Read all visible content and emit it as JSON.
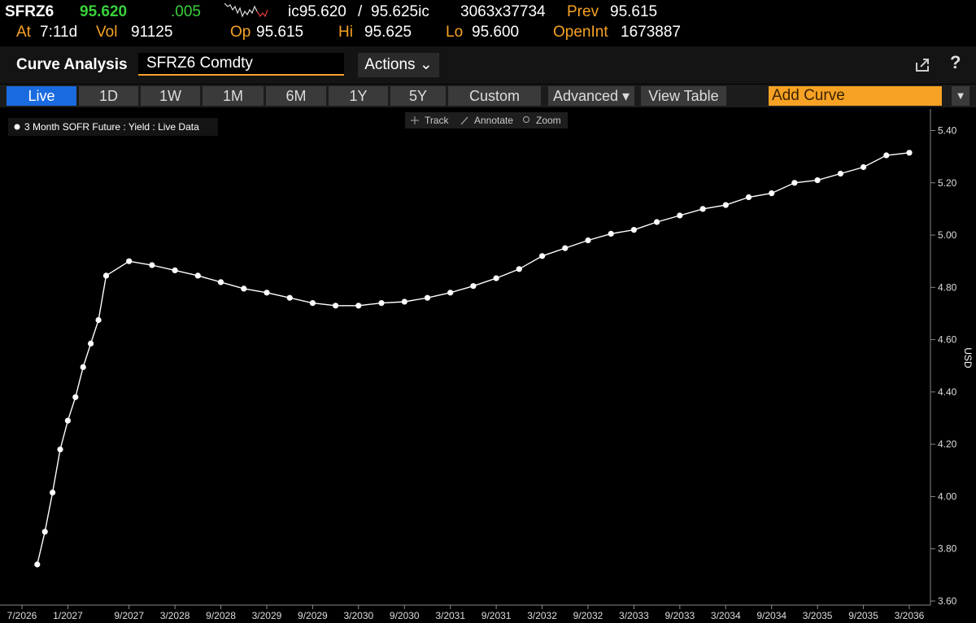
{
  "ticker": {
    "symbol": "SFRZ6",
    "last": "95.620",
    "change": ".005",
    "bid_ask_left": "ic95.620",
    "bid_ask_sep": "/",
    "bid_ask_right": "95.625ic",
    "size": "3063x37734",
    "prev_label": "Prev",
    "prev_value": "95.615",
    "at_label": "At",
    "at_time": "7:11d",
    "vol_label": "Vol",
    "vol_value": "91125",
    "op_label": "Op",
    "op_value": "95.615",
    "hi_label": "Hi",
    "hi_value": "95.625",
    "lo_label": "Lo",
    "lo_value": "95.600",
    "openint_label": "OpenInt",
    "openint_value": "1673887"
  },
  "header": {
    "title": "Curve Analysis",
    "security": "SFRZ6 Comdty",
    "actions_label": "Actions ⌄",
    "help": "?"
  },
  "toolbar": {
    "live": "Live",
    "d1": "1D",
    "w1": "1W",
    "m1": "1M",
    "m6": "6M",
    "y1": "1Y",
    "y5": "5Y",
    "custom": "Custom",
    "advanced": "Advanced ▾",
    "view_table": "View Table",
    "add_curve": "Add Curve",
    "dropdown": "▼"
  },
  "chart_tools": {
    "track": "Track",
    "annotate": "Annotate",
    "zoom": "Zoom"
  },
  "colors": {
    "background": "#000000",
    "line": "#ffffff",
    "accent": "#f7a224",
    "positive": "#3ad13a",
    "active_tab": "#1a6be0"
  },
  "chart_data": {
    "type": "line",
    "legend": "3 Month SOFR Future : Yield : Live Data",
    "ylabel": "USD",
    "ylim": [
      3.6,
      5.44
    ],
    "yticks": [
      "3.60",
      "3.80",
      "4.00",
      "4.20",
      "4.40",
      "4.60",
      "4.80",
      "5.00",
      "5.20",
      "5.40"
    ],
    "xlim": [
      "2026-07",
      "2036-05"
    ],
    "xticks": [
      "7/2026",
      "1/2027",
      "9/2027",
      "3/2028",
      "9/2028",
      "3/2029",
      "9/2029",
      "3/2030",
      "9/2030",
      "3/2031",
      "9/2031",
      "3/2032",
      "9/2032",
      "3/2033",
      "9/2033",
      "3/2034",
      "9/2034",
      "3/2035",
      "9/2035",
      "3/2036"
    ],
    "series": [
      {
        "x": [
          "2026-09",
          "2026-10",
          "2026-11",
          "2026-12",
          "2027-01",
          "2027-02",
          "2027-03",
          "2027-04",
          "2027-05",
          "2027-06",
          "2027-09",
          "2027-12",
          "2028-03",
          "2028-06",
          "2028-09",
          "2028-12",
          "2029-03",
          "2029-06",
          "2029-09",
          "2029-12",
          "2030-03",
          "2030-06",
          "2030-09",
          "2030-12",
          "2031-03",
          "2031-06",
          "2031-09",
          "2031-12",
          "2032-03",
          "2032-06",
          "2032-09",
          "2032-12",
          "2033-03",
          "2033-06",
          "2033-09",
          "2033-12",
          "2034-03",
          "2034-06",
          "2034-09",
          "2034-12",
          "2035-03",
          "2035-06",
          "2035-09",
          "2035-12",
          "2036-03"
        ],
        "values": [
          3.74,
          3.865,
          4.015,
          4.18,
          4.29,
          4.38,
          4.495,
          4.585,
          4.675,
          4.845,
          4.9,
          4.885,
          4.865,
          4.845,
          4.82,
          4.795,
          4.78,
          4.76,
          4.74,
          4.73,
          4.73,
          4.74,
          4.745,
          4.76,
          4.78,
          4.805,
          4.835,
          4.87,
          4.92,
          4.95,
          4.98,
          5.005,
          5.02,
          5.05,
          5.075,
          5.1,
          5.115,
          5.145,
          5.16,
          5.2,
          5.21,
          5.235,
          5.26,
          5.305,
          5.315
        ]
      }
    ]
  }
}
